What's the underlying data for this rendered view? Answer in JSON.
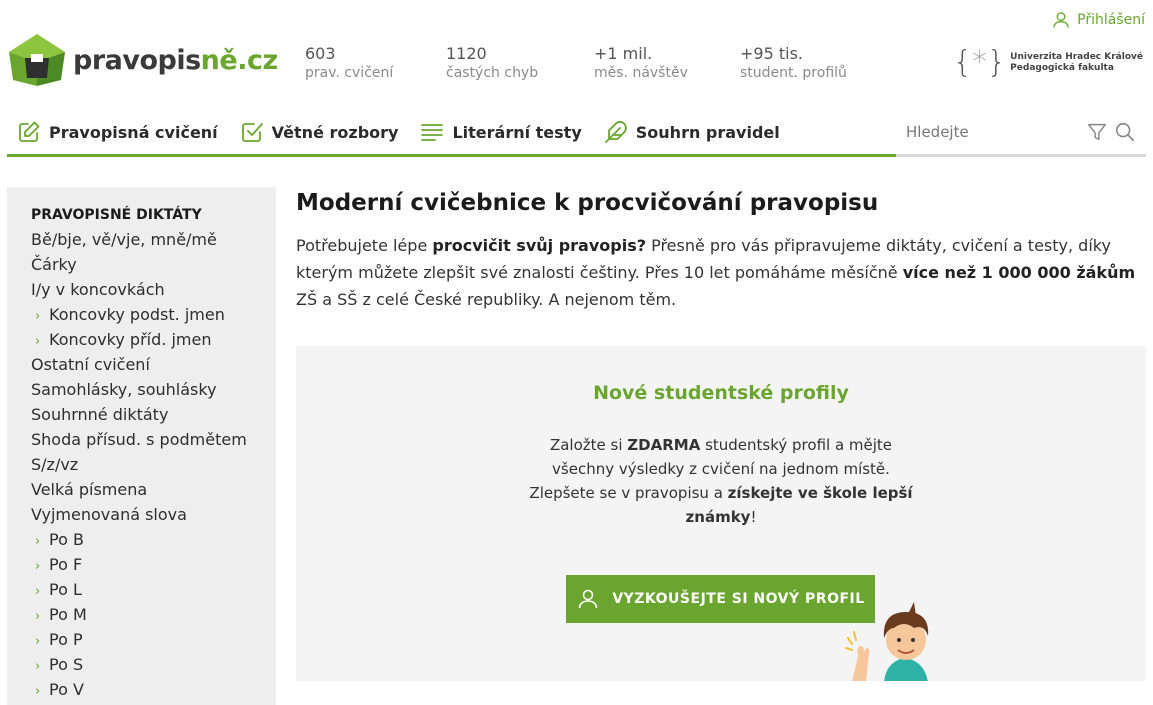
{
  "header": {
    "login_label": "Přihlášení",
    "logo": {
      "main": "pravopis",
      "accent": "ně.cz"
    },
    "stats": [
      {
        "value": "603",
        "label": "prav. cvičení"
      },
      {
        "value": "1120",
        "label": "častých chyb"
      },
      {
        "value": "+1 mil.",
        "label": "měs. návštěv"
      },
      {
        "value": "+95 tis.",
        "label": "student. profilů"
      }
    ],
    "university": {
      "line1": "Univerzita Hradec Králové",
      "line2": "Pedagogická fakulta"
    }
  },
  "nav": {
    "items": [
      {
        "label": "Pravopisná cvičení",
        "icon": "edit-icon"
      },
      {
        "label": "Větné rozbory",
        "icon": "checkbox-icon"
      },
      {
        "label": "Literární testy",
        "icon": "text-lines-icon"
      },
      {
        "label": "Souhrn pravidel",
        "icon": "feather-icon"
      }
    ],
    "search_placeholder": "Hledejte"
  },
  "sidebar": {
    "heading": "PRAVOPISNÉ DIKTÁTY",
    "items": [
      {
        "label": "Bě/bje, vě/vje, mně/mě",
        "sub": false
      },
      {
        "label": "Čárky",
        "sub": false
      },
      {
        "label": "I/y v koncovkách",
        "sub": false
      },
      {
        "label": "Koncovky podst. jmen",
        "sub": true
      },
      {
        "label": "Koncovky příd. jmen",
        "sub": true
      },
      {
        "label": "Ostatní cvičení",
        "sub": false
      },
      {
        "label": "Samohlásky, souhlásky",
        "sub": false
      },
      {
        "label": "Souhrnné diktáty",
        "sub": false
      },
      {
        "label": "Shoda přísud. s podmětem",
        "sub": false
      },
      {
        "label": "S/z/vz",
        "sub": false
      },
      {
        "label": "Velká písmena",
        "sub": false
      },
      {
        "label": "Vyjmenovaná slova",
        "sub": false
      },
      {
        "label": "Po B",
        "sub": true
      },
      {
        "label": "Po F",
        "sub": true
      },
      {
        "label": "Po L",
        "sub": true
      },
      {
        "label": "Po M",
        "sub": true
      },
      {
        "label": "Po P",
        "sub": true
      },
      {
        "label": "Po S",
        "sub": true
      },
      {
        "label": "Po V",
        "sub": true
      }
    ]
  },
  "main": {
    "title": "Moderní cvičebnice k procvičování pravopisu",
    "intro": {
      "p1": "Potřebujete lépe ",
      "b1": "procvičit svůj pravopis?",
      "p2": " Přesně pro vás připravujeme diktáty, cvičení a testy, díky kterým můžete zlepšit své znalosti češtiny. Přes 10 let pomáháme měsíčně ",
      "b2": "více než 1 000 000 žákům",
      "p3": " ZŠ a SŠ z celé České republiky. A nejenom těm."
    }
  },
  "promo": {
    "title": "Nové studentské profily",
    "t1": "Založte si ",
    "b1": "ZDARMA",
    "t2": " studentský profil a mějte všechny výsledky z cvičení na jednom místě. Zlepšete se v pravopisu a ",
    "b2": "získejte ve škole lepší známky",
    "t3": "!",
    "button_label": "VYZKOUŠEJTE SI NOVÝ PROFIL"
  },
  "colors": {
    "accent": "#6aa62f",
    "sidebar_bg": "#eeeeee",
    "promo_bg": "#f4f4f4"
  }
}
